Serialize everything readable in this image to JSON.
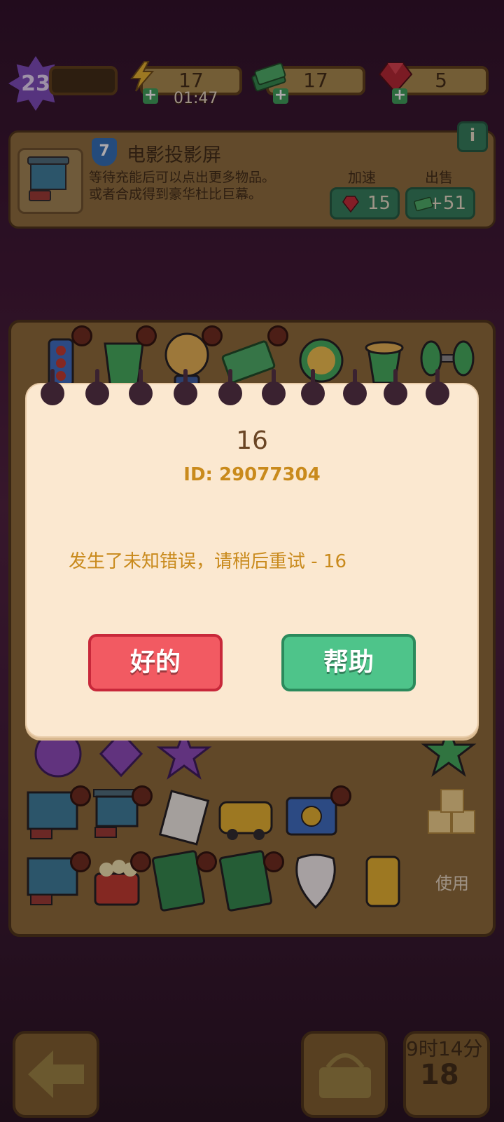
{
  "topbar": {
    "level": "23",
    "energy_value": "17",
    "energy_timer": "01:47",
    "cash_value": "17",
    "gems_value": "5"
  },
  "item_info": {
    "level": "7",
    "title": "电影投影屏",
    "description": "等待充能后可以点出更多物品。\n或者合成得到豪华杜比巨幕。",
    "speedup_label": "加速",
    "speedup_cost": "15",
    "sell_label": "出售",
    "sell_value": "+51",
    "info_icon": "i"
  },
  "board": {
    "use_label": "使用"
  },
  "bottom": {
    "timer_label": "9时14分",
    "timer_count": "18"
  },
  "dialog": {
    "title": "16",
    "id_text": "ID: 29077304",
    "message": "发生了未知错误，请稍后重试 - 16",
    "ok_label": "好的",
    "help_label": "帮助"
  },
  "colors": {
    "dialog_bg": "#fbe8d0",
    "ok_button": "#f25a62",
    "help_button": "#4ec48a",
    "message_text": "#c98a1c"
  }
}
